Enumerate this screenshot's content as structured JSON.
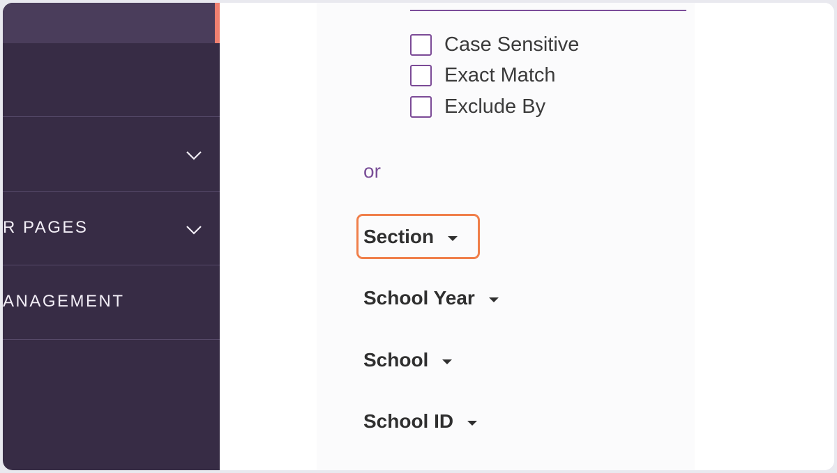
{
  "sidebar": {
    "items": [
      {
        "label": "",
        "active": true
      },
      {
        "label": ""
      },
      {
        "label": "",
        "has_chevron": true
      },
      {
        "label": "R PAGES",
        "has_chevron": true
      },
      {
        "label": "ANAGEMENT"
      }
    ],
    "colors": {
      "background": "#372c45",
      "active": "#4a3d5b",
      "accent": "#f08070"
    }
  },
  "filters": {
    "options": [
      {
        "label": "Case Sensitive",
        "checked": false
      },
      {
        "label": "Exact Match",
        "checked": false
      },
      {
        "label": "Exclude By",
        "checked": false
      }
    ],
    "separator": "or",
    "dropdowns": [
      {
        "label": "Section",
        "highlighted": true
      },
      {
        "label": "School Year"
      },
      {
        "label": "School"
      },
      {
        "label": "School ID"
      }
    ]
  },
  "colors": {
    "purple": "#7b4a96",
    "highlight": "#f07f4a"
  }
}
